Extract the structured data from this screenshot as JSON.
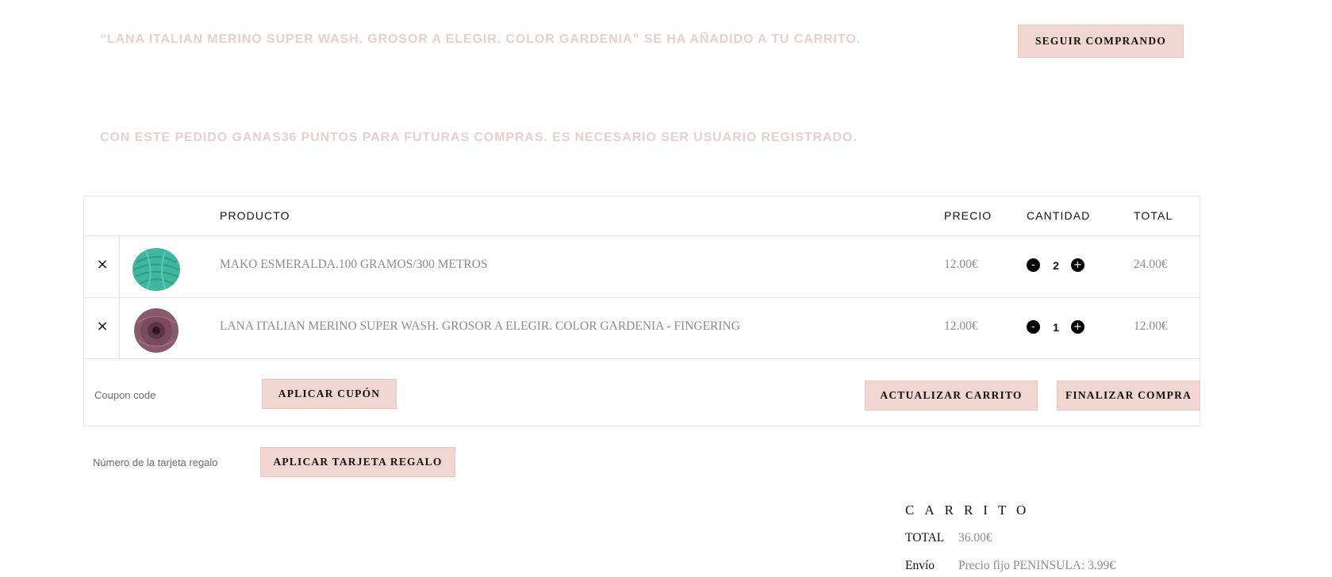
{
  "notices": {
    "added": "“LANA ITALIAN MERINO SUPER WASH. GROSOR A ELEGIR. COLOR GARDENIA” SE HA AÑADIDO A TU CARRITO.",
    "continue_button": "SEGUIR COMPRANDO",
    "points": "CON ESTE PEDIDO GANAS36 PUNTOS PARA FUTURAS COMPRAS. ES NECESARIO SER USUARIO REGISTRADO."
  },
  "table": {
    "headers": {
      "product": "PRODUCTO",
      "price": "PRECIO",
      "quantity": "CANTIDAD",
      "total": "TOTAL"
    },
    "rows": [
      {
        "remove_symbol": "×",
        "product": "MAKO ESMERALDA.100 GRAMOS/300 METROS",
        "price": "12.00€",
        "quantity": "2",
        "total": "24.00€",
        "thumb_color": "#3fb79f"
      },
      {
        "remove_symbol": "×",
        "product": "LANA ITALIAN MERINO SUPER WASH. GROSOR A ELEGIR. COLOR GARDENIA - FINGERING",
        "price": "12.00€",
        "quantity": "1",
        "total": "12.00€",
        "thumb_color": "#8a5a6c"
      }
    ],
    "qty_minus": "-",
    "qty_plus": "+"
  },
  "actions": {
    "coupon_placeholder": "Coupon code",
    "apply_coupon": "APLICAR CUPÓN",
    "update_cart": "ACTUALIZAR CARRITO",
    "checkout": "FINALIZAR COMPRA"
  },
  "gift": {
    "placeholder": "Número de la tarjeta regalo",
    "apply": "APLICAR TARJETA REGALO"
  },
  "totals": {
    "title": "CARRITO",
    "total_label": "TOTAL",
    "total_value": "36.00€",
    "shipping_label": "Envío",
    "shipping_value": "Precio fijo PENINSULA: 3.99€"
  },
  "colors": {
    "notice_text": "#e8cfca",
    "button_bg": "#f1d6d2",
    "border": "#e6e6e6"
  }
}
